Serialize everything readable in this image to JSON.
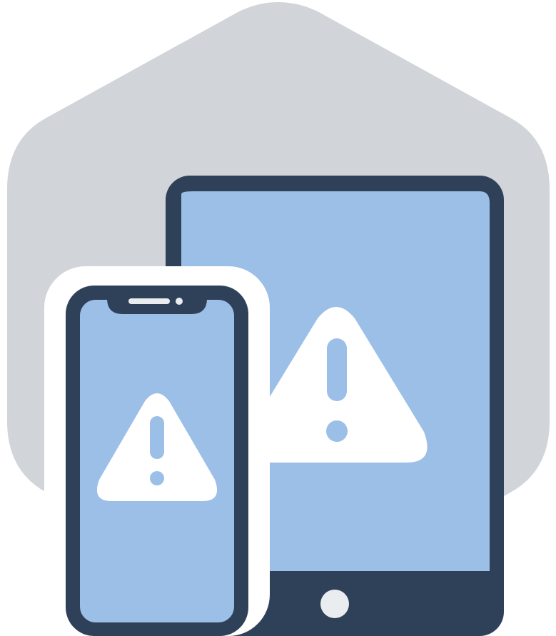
{
  "illustration": {
    "icons": [
      "hexagon-background",
      "tablet-device-icon",
      "phone-device-icon",
      "warning-icon"
    ],
    "colors": {
      "hexagon": "#d1d5d9",
      "frame": "#2f4158",
      "screen": "#9bbfe6",
      "warning": "#ffffff",
      "home_button": "#e9edf0",
      "outline": "#ffffff"
    }
  }
}
